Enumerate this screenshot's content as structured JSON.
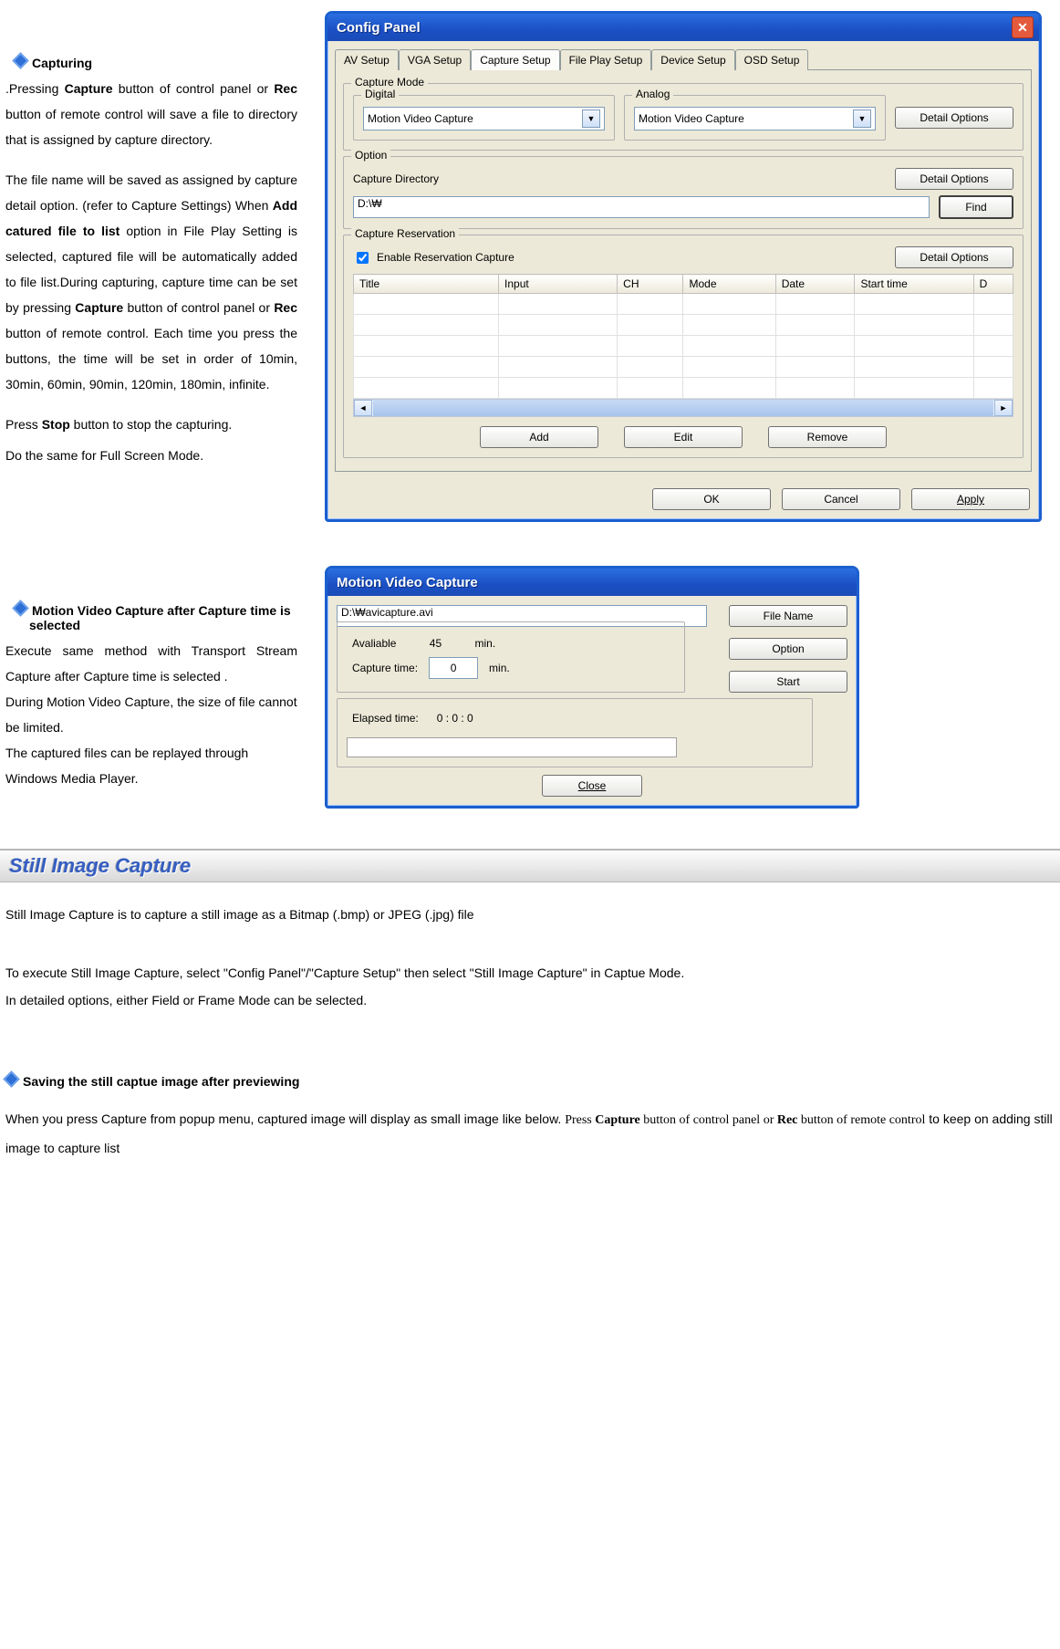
{
  "sections": {
    "capturing": {
      "heading": "Capturing",
      "p1_a": ".Pressing ",
      "p1_b": "Capture",
      "p1_c": " button of control panel or ",
      "p1_d": "Rec",
      "p1_e": " button of remote control will save a file to directory that is assigned by capture directory.",
      "p2_a": "The file name will be saved as assigned by capture detail option. (refer to Capture Settings) When ",
      "p2_b": "Add catured file to list",
      "p2_c": " option in File Play Setting is selected, captured file will be automatically added to file list.During capturing, capture time can be set by pressing ",
      "p2_d": "Capture",
      "p2_e": " button of control panel or ",
      "p2_f": "Rec",
      "p2_g": " button of remote control. Each time you press the buttons, the time will be set in order of   10min, 30min, 60min, 90min, 120min, 180min, infinite.",
      "p3_a": "Press ",
      "p3_b": "Stop",
      "p3_c": " button to stop the capturing.",
      "p4": "Do the same for Full Screen Mode."
    },
    "mvc": {
      "heading": "Motion Video Capture after Capture time is selected",
      "l1": "Execute same method with Transport Stream Capture after Capture time is selected .",
      "l2": "During Motion Video Capture, the size of file cannot be limited.",
      "l3": "The captured files can be replayed through Windows Media Player."
    },
    "still": {
      "header": "Still Image Capture",
      "intro": "Still Image Capture is to capture a still image as a Bitmap (.bmp) or JPEG (.jpg) file",
      "howto": "To execute Still Image Capture, select \"Config Panel\"/\"Capture Setup\" then select \"Still Image Capture\" in Captue Mode.",
      "howto2": "In detailed options, either Field or Frame Mode can be selected.",
      "sub": "Saving the still captue image after previewing",
      "last_a": "When you press Capture from popup menu, captured image will display as small image  like below. ",
      "last_b": "Press ",
      "last_c": "Capture",
      "last_d": " button of control panel or ",
      "last_e": "Rec",
      "last_f": " button of remote control",
      "last_g": " to keep on adding still image to capture list"
    }
  },
  "config_panel": {
    "title": "Config Panel",
    "tabs": [
      "AV Setup",
      "VGA Setup",
      "Capture Setup",
      "File Play Setup",
      "Device Setup",
      "OSD Setup"
    ],
    "capture_mode": {
      "legend": "Capture Mode",
      "digital_legend": "Digital",
      "analog_legend": "Analog",
      "digital_value": "Motion Video Capture",
      "analog_value": "Motion Video Capture",
      "detail_options": "Detail Options"
    },
    "option": {
      "legend": "Option",
      "capture_directory": "Capture Directory",
      "detail_options": "Detail Options",
      "path": "D:\\₩",
      "find": "Find"
    },
    "reservation": {
      "legend": "Capture Reservation",
      "enable": "Enable Reservation Capture",
      "detail_options": "Detail Options",
      "cols": [
        "Title",
        "Input",
        "CH",
        "Mode",
        "Date",
        "Start time",
        "D"
      ],
      "add": "Add",
      "edit": "Edit",
      "remove": "Remove"
    },
    "ok": "OK",
    "cancel": "Cancel",
    "apply": "Apply"
  },
  "mvc_panel": {
    "title": "Motion Video Capture",
    "path": "D:\\₩avicapture.avi",
    "file_name": "File Name",
    "option": "Option",
    "start": "Start",
    "avail_label": "Avaliable",
    "avail_value": "45",
    "min": "min.",
    "ct_label": "Capture time:",
    "ct_value": "0",
    "elapsed_label": "Elapsed time:",
    "elapsed": "0   :       0  :      0",
    "close": "Close"
  }
}
